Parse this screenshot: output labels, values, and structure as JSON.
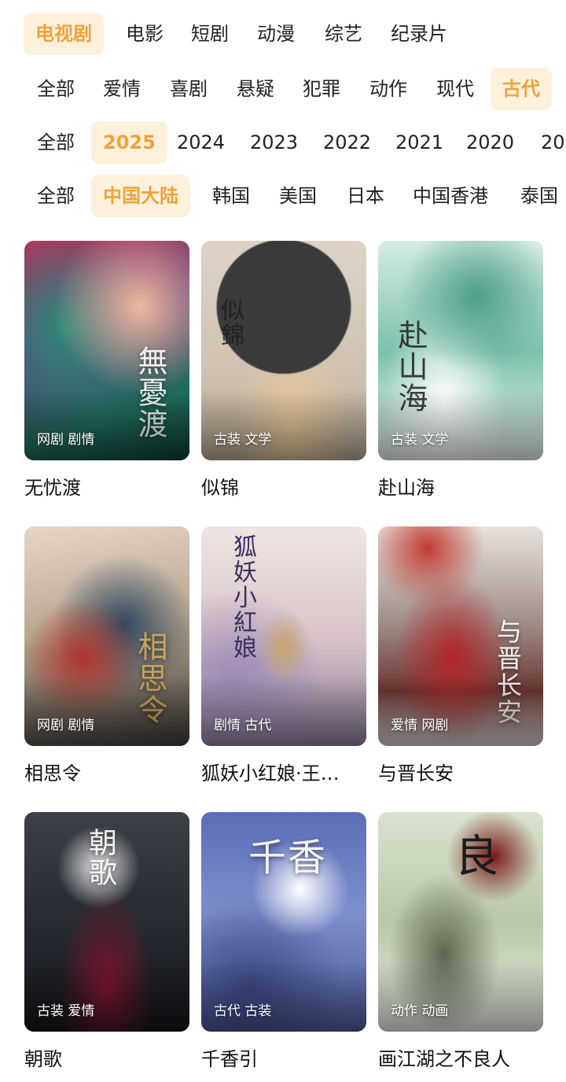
{
  "category_tabs": [
    "电视剧",
    "电影",
    "短剧",
    "动漫",
    "综艺",
    "纪录片"
  ],
  "category_active": "电视剧",
  "genre_filters": [
    "全部",
    "爱情",
    "喜剧",
    "悬疑",
    "犯罪",
    "动作",
    "现代",
    "古代"
  ],
  "genre_active": "古代",
  "year_filters": [
    "全部",
    "2025",
    "2024",
    "2023",
    "2022",
    "2021",
    "2020",
    "20"
  ],
  "year_active": "2025",
  "region_filters": [
    "全部",
    "中国大陆",
    "韩国",
    "美国",
    "日本",
    "中国香港",
    "泰国"
  ],
  "region_active": "中国大陆",
  "shows": [
    {
      "title": "无忧渡",
      "tags": "网剧 剧情",
      "poster_text": "無憂渡"
    },
    {
      "title": "似锦",
      "tags": "古装 文学",
      "poster_text": "似錦"
    },
    {
      "title": "赴山海",
      "tags": "古装 文学",
      "poster_text": "赴山海"
    },
    {
      "title": "相思令",
      "tags": "网剧 剧情",
      "poster_text": "相思令"
    },
    {
      "title": "狐妖小红娘·王…",
      "tags": "剧情 古代",
      "poster_text": "狐妖小紅娘"
    },
    {
      "title": "与晋长安",
      "tags": "爱情 网剧",
      "poster_text": "与晋长安"
    },
    {
      "title": "朝歌",
      "tags": "古装 爱情",
      "poster_text": "朝歌"
    },
    {
      "title": "千香引",
      "tags": "古代 古装",
      "poster_text": "千香"
    },
    {
      "title": "画江湖之不良人",
      "tags": "动作 动画",
      "poster_text": "良"
    }
  ],
  "colors": {
    "accent": "#f0a23a",
    "active_chip_bg": "#fdf1dc"
  }
}
